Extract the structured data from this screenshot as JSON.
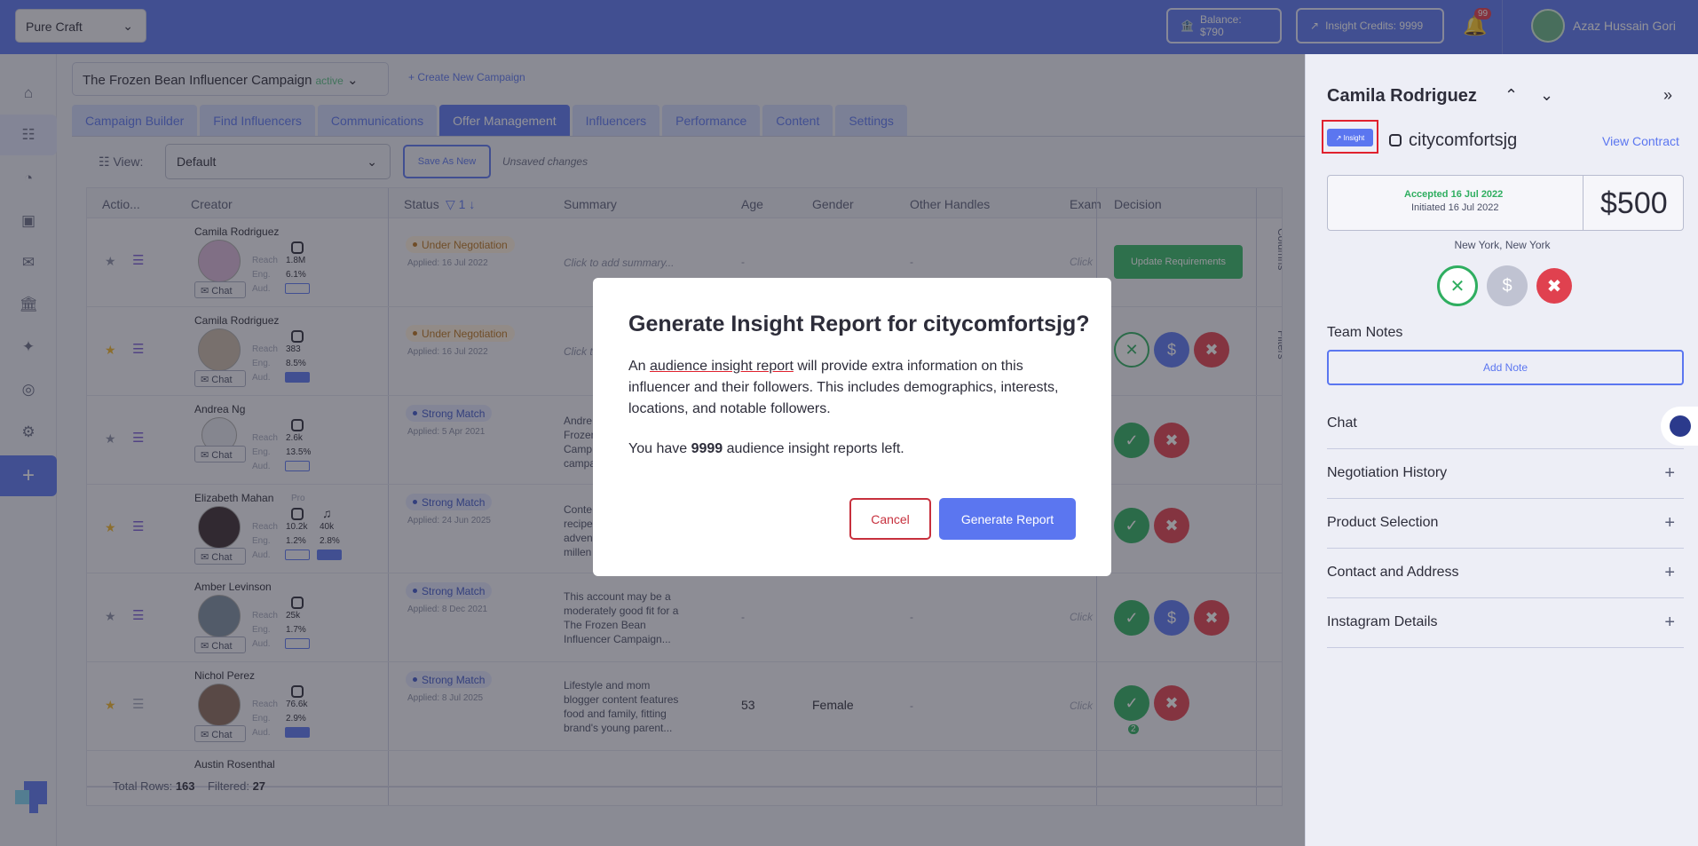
{
  "topbar": {
    "workspace": "Pure Craft",
    "balance": "Balance: $790",
    "insight_credits": "Insight Credits: 9999",
    "notif_count": "99",
    "user_name": "Azaz Hussain Gori"
  },
  "campaign": {
    "name": "The Frozen Bean Influencer Campaign",
    "status": "active",
    "create_label": "Create New Campaign"
  },
  "tabs": [
    "Campaign Builder",
    "Find Influencers",
    "Communications",
    "Offer Management",
    "Influencers",
    "Performance",
    "Content",
    "Settings"
  ],
  "active_tab": "Offer Management",
  "toolbar": {
    "view_label": "View:",
    "view_value": "Default",
    "save_as_new": "Save As New",
    "unsaved": "Unsaved changes"
  },
  "table": {
    "headers": [
      "Actio...",
      "Creator",
      "Status",
      "1",
      "Summary",
      "Age",
      "Gender",
      "Other Handles",
      "Exam",
      "Decision"
    ],
    "metric_labels": [
      "Reach",
      "Eng.",
      "Aud."
    ],
    "chat_label": "Chat",
    "side_tabs": [
      "Columns",
      "Filters"
    ],
    "rows": [
      {
        "name": "Camila Rodriguez",
        "reach": "1.8M",
        "eng": "6.1%",
        "status": "Under Negotiation",
        "applied": "Applied: 16 Jul 2022",
        "summary": "Click to add summary...",
        "age": "-",
        "gender": "",
        "handles": "-",
        "exam": "Click",
        "decision": "Update Requirements"
      },
      {
        "name": "Camila Rodriguez",
        "reach": "383",
        "eng": "8.5%",
        "status": "Under Negotiation",
        "applied": "Applied: 16 Jul 2022",
        "summary": "Click t",
        "age": "",
        "gender": "",
        "handles": "",
        "exam": "",
        "decision": ""
      },
      {
        "name": "Andrea Ng",
        "reach": "2.6k",
        "eng": "13.5%",
        "status": "Strong Match",
        "applied": "Applied: 5 Apr 2021",
        "summary": "Andre Frozen Camp campa",
        "age": "",
        "gender": "",
        "handles": "",
        "exam": "",
        "decision": ""
      },
      {
        "name": "Elizabeth Mahan",
        "pro": "Pro",
        "reach": "10.2k",
        "eng": "1.2%",
        "reach2": "40k",
        "eng2": "2.8%",
        "status": "Strong Match",
        "applied": "Applied: 24 Jun 2025",
        "summary": "Conte recipe adven millen",
        "age": "",
        "gender": "",
        "handles": "",
        "exam": "",
        "decision": ""
      },
      {
        "name": "Amber Levinson",
        "reach": "25k",
        "eng": "1.7%",
        "status": "Strong Match",
        "applied": "Applied: 8 Dec 2021",
        "summary": "This account may be a moderately good fit for a The Frozen Bean Influencer Campaign...",
        "age": "-",
        "gender": "",
        "handles": "-",
        "exam": "Click",
        "decision": ""
      },
      {
        "name": "Nichol Perez",
        "reach": "76.6k",
        "eng": "2.9%",
        "status": "Strong Match",
        "applied": "Applied: 8 Jul 2025",
        "summary": "Lifestyle and mom blogger content features food and family, fitting brand's young parent...",
        "age": "53",
        "gender": "Female",
        "handles": "-",
        "exam": "Click",
        "decision": "",
        "count": "2"
      },
      {
        "name": "Austin Rosenthal"
      }
    ],
    "footer_total_label": "Total Rows:",
    "footer_total": "163",
    "footer_filtered_label": "Filtered:",
    "footer_filtered": "27"
  },
  "panel": {
    "name": "Camila Rodriguez",
    "insight_label": "Insight",
    "handle": "citycomfortsjg",
    "view_contract": "View Contract",
    "accepted": "Accepted 16 Jul 2022",
    "initiated": "Initiated 16 Jul 2022",
    "amount": "$500",
    "location": "New York, New York",
    "team_notes": "Team Notes",
    "add_note": "Add Note",
    "sections": [
      "Chat",
      "Negotiation History",
      "Product Selection",
      "Contact and Address",
      "Instagram Details"
    ]
  },
  "modal": {
    "title": "Generate Insight Report for citycomfortsjg?",
    "body_pre": "An ",
    "body_link": "audience insight report",
    "body_post": " will provide extra information on this influencer and their followers. This includes demographics, interests, locations, and notable followers.",
    "count_pre": "You have ",
    "count": "9999",
    "count_post": " audience insight reports left.",
    "cancel": "Cancel",
    "generate": "Generate Report"
  },
  "colors": {
    "primary": "#5b76f0",
    "accept": "#2fae60",
    "reject": "#e0414f",
    "highlight": "#e0212e"
  }
}
